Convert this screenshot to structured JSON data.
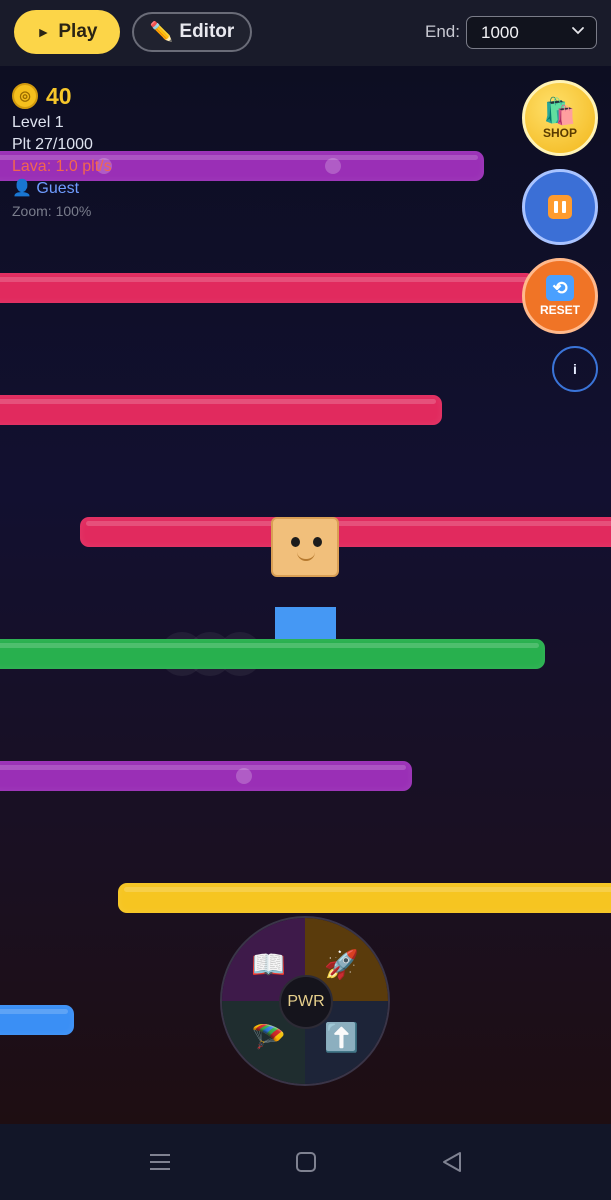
{
  "toolbar": {
    "play_label": "Play",
    "editor_label": "Editor",
    "end_label": "End:",
    "end_value": "1000"
  },
  "hud": {
    "coins": "40",
    "level": "Level 1",
    "platform": "Plt 27/1000",
    "lava": "Lava: 1.0 plt/s",
    "user": "Guest",
    "zoom": "Zoom: 100%"
  },
  "side_buttons": {
    "shop_label": "SHOP",
    "reset_label": "RESET",
    "info_label": "i"
  },
  "power_wheel": {
    "hub_label": "PWR",
    "slots": [
      "book-icon",
      "rocket-icon",
      "parachute-icon",
      "up-arrow-icon"
    ]
  },
  "colors": {
    "play_button": "#fcd548",
    "platform_purple": "#9a2fb6",
    "platform_pink": "#e12a5e",
    "platform_green": "#28b04e",
    "platform_yellow": "#f6c521",
    "platform_blue": "#3a8ff5",
    "lava_text": "#f2664f"
  }
}
